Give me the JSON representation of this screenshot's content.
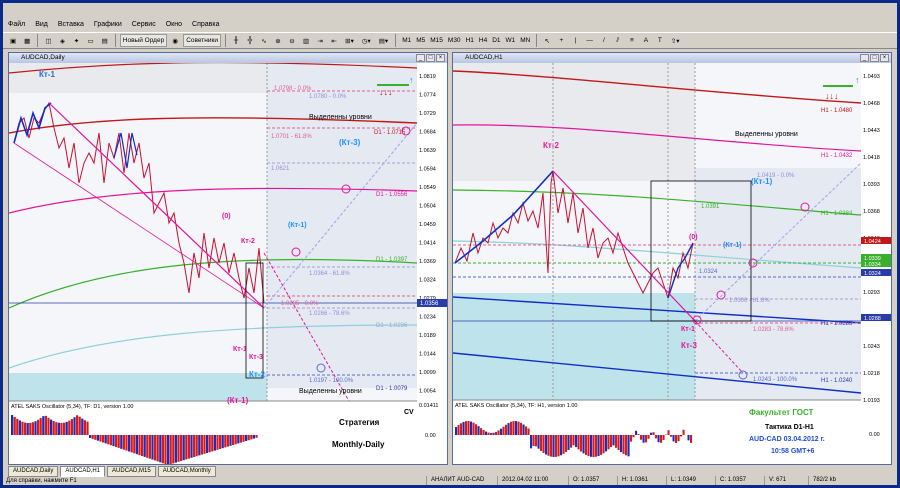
{
  "menu": [
    "Файл",
    "Вид",
    "Вставка",
    "Графики",
    "Сервис",
    "Окно",
    "Справка"
  ],
  "toolbar": {
    "new_order": "Новый Ордер",
    "advisors": "Советники",
    "timeframes": [
      "M1",
      "M5",
      "M15",
      "M30",
      "H1",
      "H4",
      "D1",
      "W1",
      "MN"
    ]
  },
  "windows": [
    {
      "title": "AUDCAD,Daily",
      "scale": [
        "1.0819",
        "1.0774",
        "1.0729",
        "1.0684",
        "1.0639",
        "1.0594",
        "1.0549",
        "1.0504",
        "1.0459",
        "1.0414",
        "1.0369",
        "1.0324",
        "1.0279",
        "1.0234",
        "1.0189",
        "1.0144",
        "1.0099",
        "1.0054"
      ],
      "price_box": "1.0356",
      "ind_scale": [
        "0.01411",
        "0.00"
      ],
      "levels": [
        "1.0798 - 0.0%",
        "1.0780 - 0.0%",
        "1.0701 - 61.8%",
        "1.0621",
        "1.0364 - 61.8%",
        "1.0285 - 0.0%",
        "1.0266 - 78.6%",
        "1.0197 - 100.0%"
      ],
      "d1_labels": [
        "D1 - 1.0715",
        "D1 - 1.0556",
        "D1 - 1.0397",
        "D1 - 1.0236",
        "D1 - 1.0079"
      ],
      "tags": [
        "Кт-1",
        "Кт-3",
        "(Кт-3)",
        "(0)",
        "Кт-2",
        "(Кт-1)",
        "Кт-1",
        "Кт-2",
        "(Кт-1)"
      ],
      "levels_text": "Выделенны уровни",
      "levels_text_bottom": "Выделенны уровни",
      "indicator": "ATEL SAKS Oscillator (5,34), TF: D1, version 1.00",
      "cv": "CV",
      "strategy": "Стратегия",
      "strategy2": "Monthly-Daily"
    },
    {
      "title": "AUDCAD,H1",
      "scale": [
        "1.0493",
        "1.0468",
        "1.0443",
        "1.0418",
        "1.0393",
        "1.0368",
        "1.0343",
        "1.0318",
        "1.0293",
        "1.0268",
        "1.0243",
        "1.0218",
        "1.0193"
      ],
      "price_boxes": [
        "1.0424",
        "1.0339",
        "1.0334",
        "1.0324",
        "1.0288"
      ],
      "ind_scale": [
        "0.00"
      ],
      "levels": [
        "1.0419 - 0.0%",
        "1.0391",
        "1.0324",
        "1.0306 - 61.8%",
        "1.0283 - 78.6%",
        "1.0243 - 100.0%"
      ],
      "h1_labels": [
        "H1 - 1.0480",
        "H1 - 1.0432",
        "H1 - 1.0384",
        "H1 - 1.0288",
        "H1 - 1.0240"
      ],
      "tags": [
        "Кт-2",
        "(Кт-1)",
        "(0)",
        "(Кт-1)",
        "Кт-1",
        "Кт-3"
      ],
      "levels_text": "Выделенны уровни",
      "indicator": "ATEL SAKS Oscillator (5,34), TF: H1, version 1.00",
      "faculty": "Факультет ГОСТ",
      "tactic": "Тактика  D1-H1",
      "instrument_date": "AUD-CAD 03.04.2012 г.",
      "time": "10:58  GMT+6"
    }
  ],
  "tabs": [
    "AUDCAD,Daily",
    "AUDCAD,H1",
    "AUDCAD,M15",
    "AUDCAD,Monthly"
  ],
  "status": {
    "help": "Для справки, нажмите F1",
    "profile": "АНАЛИТ AUD-CAD",
    "datetime": "2012.04.02 11:00",
    "open": "O: 1.0357",
    "high": "H: 1.0361",
    "low": "L: 1.0349",
    "close": "C: 1.0357",
    "volume": "V: 671",
    "traffic": "782/2 kb"
  },
  "colors": {
    "magenta": "#e5159a",
    "blue": "#0f2fc8",
    "red": "#c21818",
    "green": "#3ab02b",
    "cyan": "#8fd0de"
  }
}
